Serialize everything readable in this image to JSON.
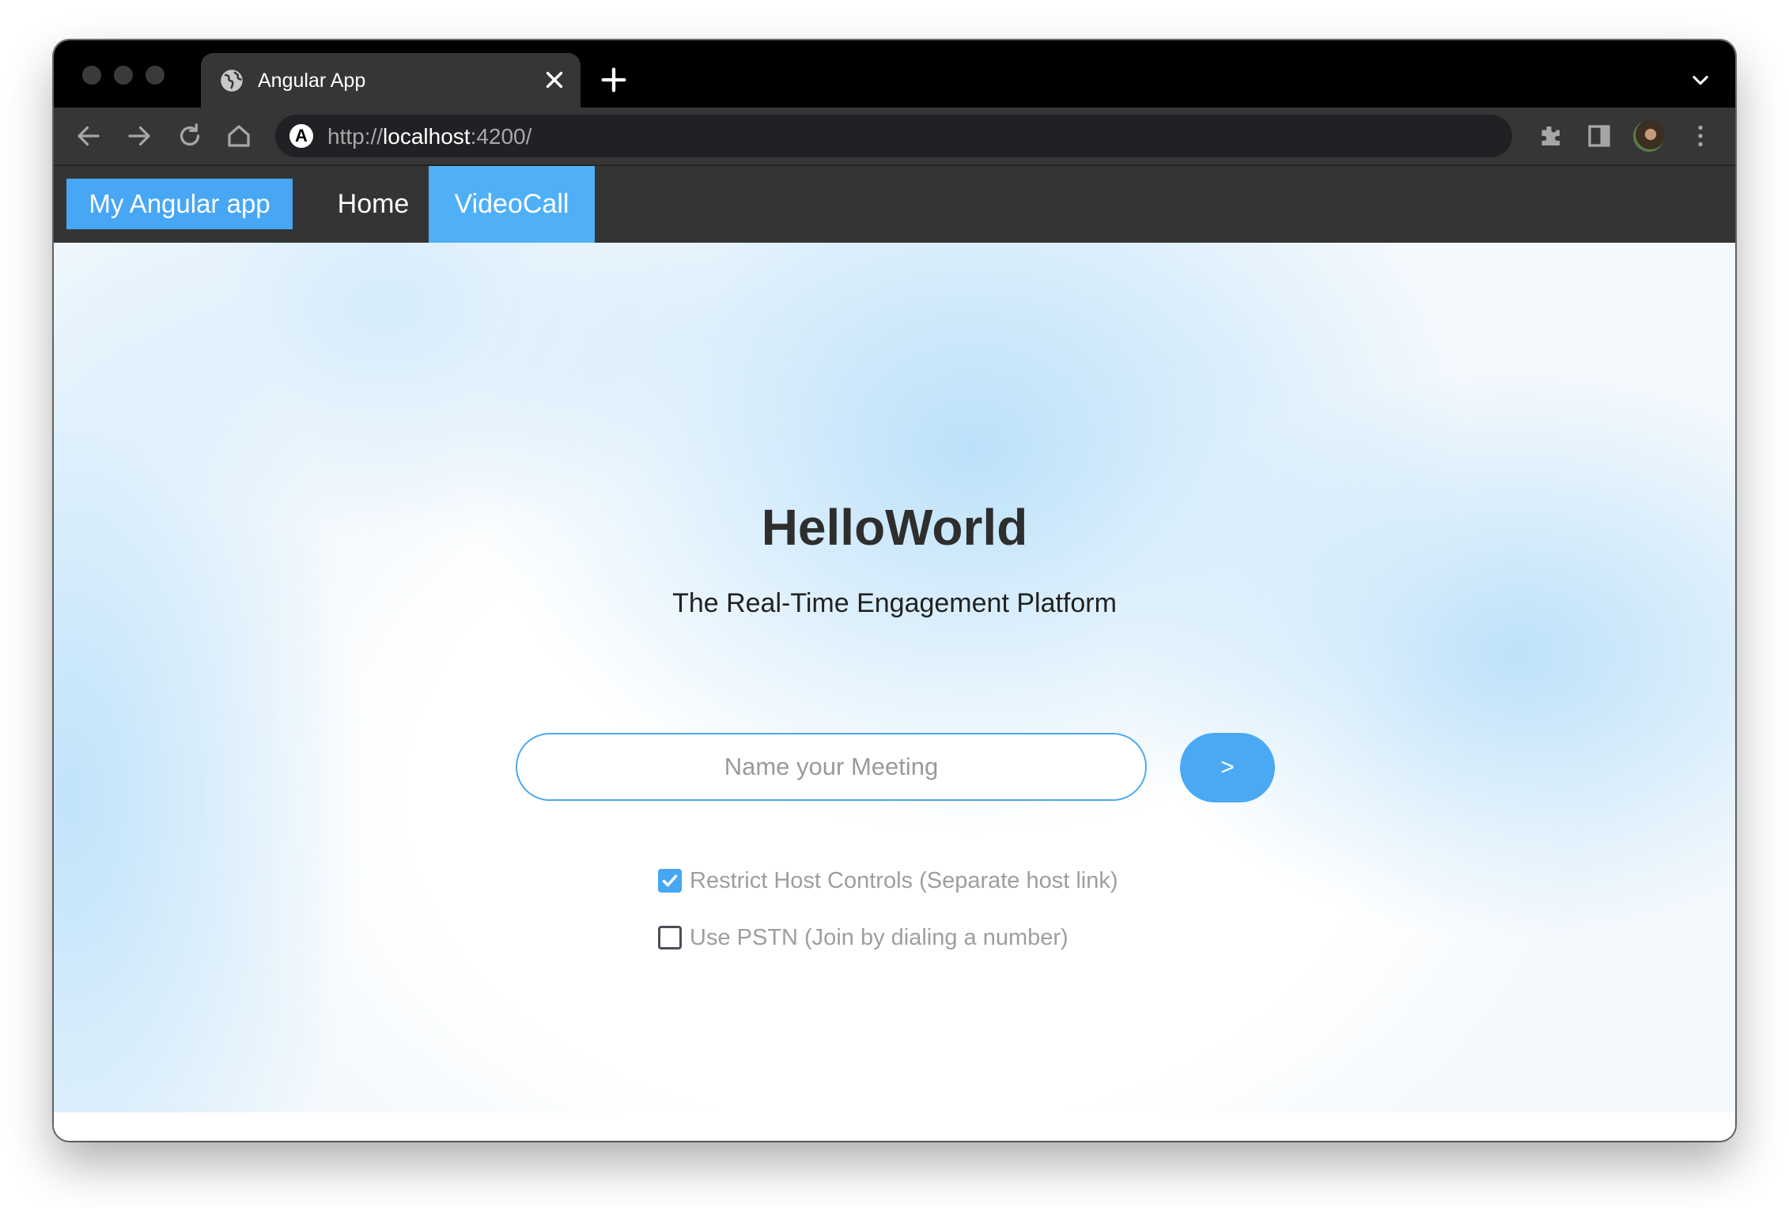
{
  "browser": {
    "tab_title": "Angular App",
    "url_scheme": "http://",
    "url_host": "localhost",
    "url_rest": ":4200/",
    "url_badge": "A"
  },
  "nav": {
    "brand": "My Angular app",
    "home": "Home",
    "videocall": "VideoCall",
    "active_item": "VideoCall"
  },
  "page": {
    "title": "HelloWorld",
    "subtitle": "The Real-Time Engagement Platform",
    "meeting_placeholder": "Name your Meeting",
    "meeting_value": "",
    "go_label": ">",
    "options": [
      {
        "label": "Restrict Host Controls (Separate host link)",
        "checked": true
      },
      {
        "label": "Use PSTN (Join by dialing a number)",
        "checked": false
      }
    ]
  },
  "colors": {
    "accent": "#47a7f5",
    "nav_bg": "#343434",
    "chrome_bg": "#363636"
  },
  "icons": {
    "tab_favicon": "globe-icon",
    "tab_close": "close-icon",
    "new_tab": "plus-icon",
    "back": "arrow-left-icon",
    "forward": "arrow-right-icon",
    "reload": "reload-icon",
    "home": "home-icon",
    "extensions": "puzzle-icon",
    "side_panel": "side-panel-icon",
    "menu": "kebab-menu-icon",
    "tab_search": "chevron-down-icon",
    "check": "checkmark-icon"
  }
}
